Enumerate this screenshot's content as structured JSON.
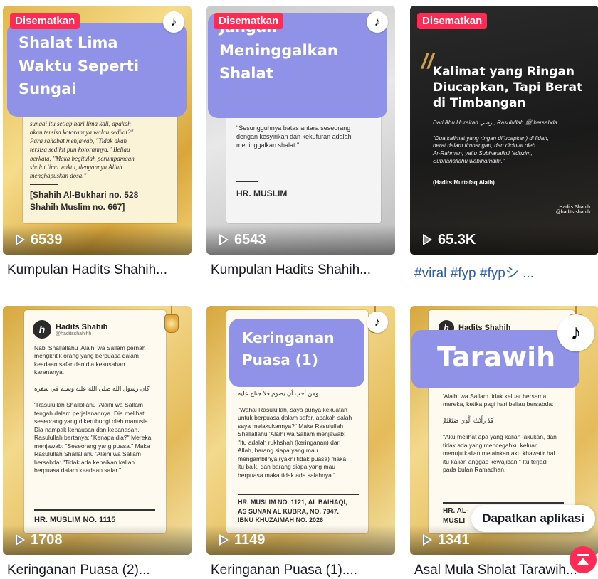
{
  "pinned_label": "Disematkan",
  "get_app_label": "Dapatkan aplikasi",
  "videos": [
    {
      "title_overlay": "Shalat Lima\nWaktu Seperti\nSungai",
      "body_text": "sungai itu setiap hari lima kali, apakah\nakan tersisa kotorannya walau sedikit?\"\nPara sahabat menjawab, \"Tidak akan\ntersisa sedikit pun kotorannya.\" Beliau\nberkata, \"Maka begitulah perumpamaan\nshalat lima waktu, dengannya Allah\nmenghapuskan dosa.\"",
      "reference": "[Shahih Al-Bukhari no. 528\nShahih Muslim no. 667]",
      "views": "6539",
      "caption": "Kumpulan Hadits Shahih..."
    },
    {
      "title_overlay": "Jangan\nMeninggalkan\nShalat",
      "body_text": "\"Sesungguhnya batas antara seseorang\ndengan kesyirikan dan kekufuran adalah\nmeninggalkan shalat.\"",
      "reference": "HR. MUSLIM",
      "views": "6543",
      "caption": "Kumpulan Hadits Shahih..."
    },
    {
      "title_overlay": "Kalimat yang Ringan\nDiucapkan, Tapi Berat\ndi Timbangan",
      "body_text": "Dari Abu Hurairah رضي , Rasulullah ﷺ bersabda :\n\n\"Dua kalimat yang ringan di(ucapkan) di lidah,\nberat dalam timbangan, dan dicintai oleh\nAr-Rahman, yaitu Subhanallhil 'adhzim,\nSubhanallahu wabihamdihi.\"",
      "reference": "(Hadits Muttafaq Alaih)",
      "brand": "Hadits Shahih\n@hadits.shahih",
      "views": "65.3K",
      "caption": "#viral #fyp #fypシ ..."
    },
    {
      "channel_name": "Hadits Shahih",
      "channel_handle": "@haditsshahihh",
      "body_text": "Nabi Shallallahu 'Alaihi wa Sallam pernah\nmengkritik orang yang berpuasa dalam\nkeadaan safar dan dia kesusahan\nkarenanya.\n\nكان رسول الله صلى الله عليه وسلم في سفره\n\n\"Rasulullah Shallallahu 'Alaihi wa Sallam\ntengah dalam perjalanannya. Dia melihat\nseseorang yang dikerubungi oleh manusia.\nDia nampak kehausan dan kepanasan.\nRasulullah bertanya: \"Kenapa dia?\" Mereka\nmenjawab: \"Seseorang yang puasa.\" Maka\nRasulullah Shallallahu 'Alaihi wa Sallam\nbersabda: \"Tidak ada kebaikan kalian\nberpuasa dalam keadaan safar.\"",
      "reference": "HR. MUSLIM NO. 1115",
      "views": "1708",
      "caption": "Keringanan Puasa (2)..."
    },
    {
      "title_overlay": "Keringanan\nPuasa (1)",
      "body_text": "ومن أحب أن يصوم فلا جناح عليه\n\n\"Wahai Rasulullah, saya punya kekuatan\nuntuk berpuasa dalam safar, apakah salah\nsaya melakukannya?\" Maka Rasulullah\nShallallahu 'Alaihi wa Sallam menjawab:\n\"Itu adalah rukhshah (keringanan) dari\nAllah, barang siapa yang mau\nmengambilnya (yakni tidak puasa) maka\nitu baik, dan barang siapa yang mau\nberpuasa maka tidak ada salahnya.\"",
      "reference": "HR. MUSLIM NO. 1121, AL BAIHAQI,\nAS SUNAN AL KUBRA, NO. 7947.\nIBNU KHUZAIMAH NO. 2026",
      "views": "1149",
      "caption": "Keringanan Puasa (1)...."
    },
    {
      "title_overlay": "Tarawih",
      "channel_name": "Hadits Shahih",
      "body_text": "'Alaihi wa Sallam tidak keluar bersama\nmereka, ketika pagi hari beliau bersabda:\n\nقَدْ رَأَيْتُ الَّذِي صَنَعْتُمْ\n\n\"Aku melihat apa yang kalian lakukan, dan\ntidak ada yang mencegahku keluar\nmenuju kalian melainkan aku khawatir hal\nitu kalian anggap kewajiban.\" Itu terjadi\npada bulan Ramadhan.",
      "reference": "HR. AL-\nMUSLI",
      "views": "1341",
      "caption": "Asal Mula Sholat Tarawih..."
    }
  ]
}
